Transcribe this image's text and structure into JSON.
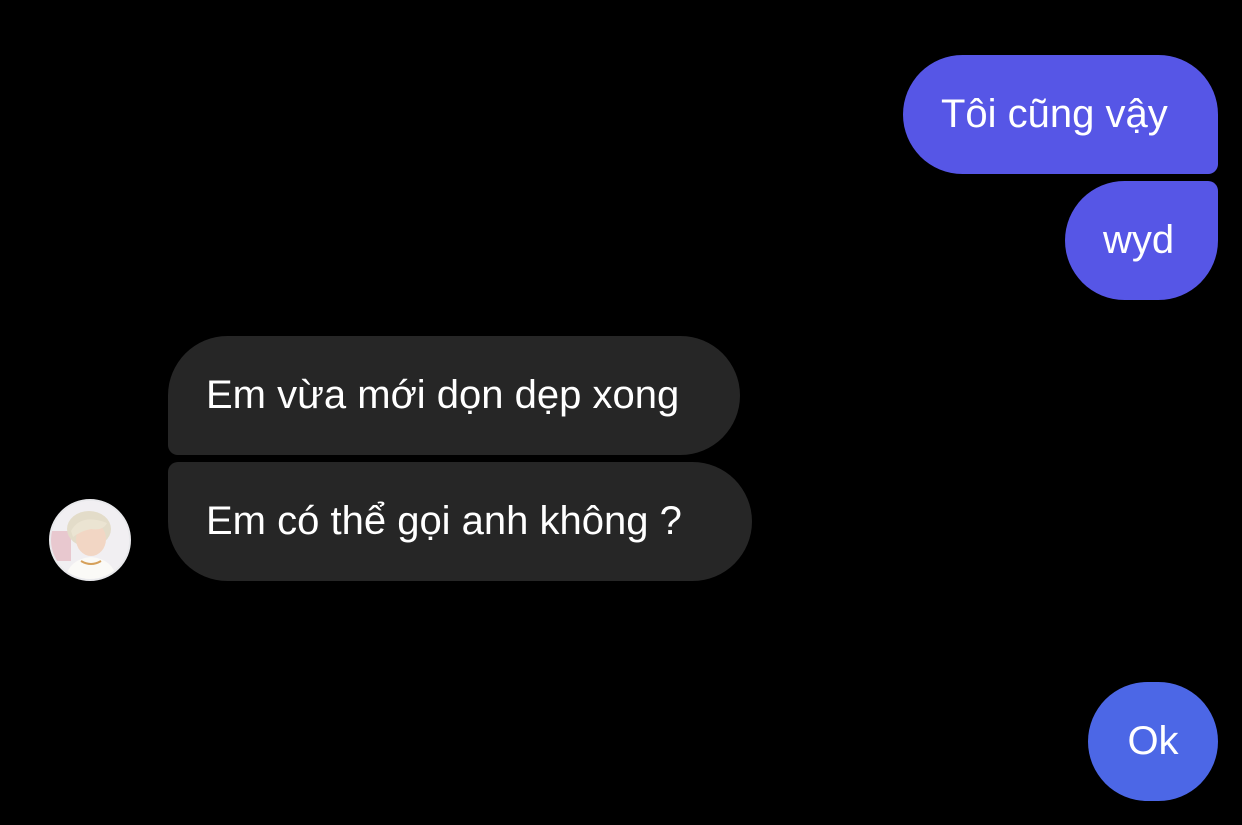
{
  "messages": {
    "outgoing_1": "Tôi cũng vậy",
    "outgoing_2": "wyd",
    "incoming_1": "Em vừa mới dọn dẹp xong",
    "incoming_2": "Em có thể gọi anh không ?",
    "outgoing_3": "Ok"
  },
  "colors": {
    "background": "#000000",
    "outgoing_bubble": "#5656e6",
    "outgoing_bubble_last": "#4c67e6",
    "incoming_bubble": "#262626",
    "text": "#ffffff"
  },
  "icons": {
    "avatar": "contact-avatar-photo"
  }
}
